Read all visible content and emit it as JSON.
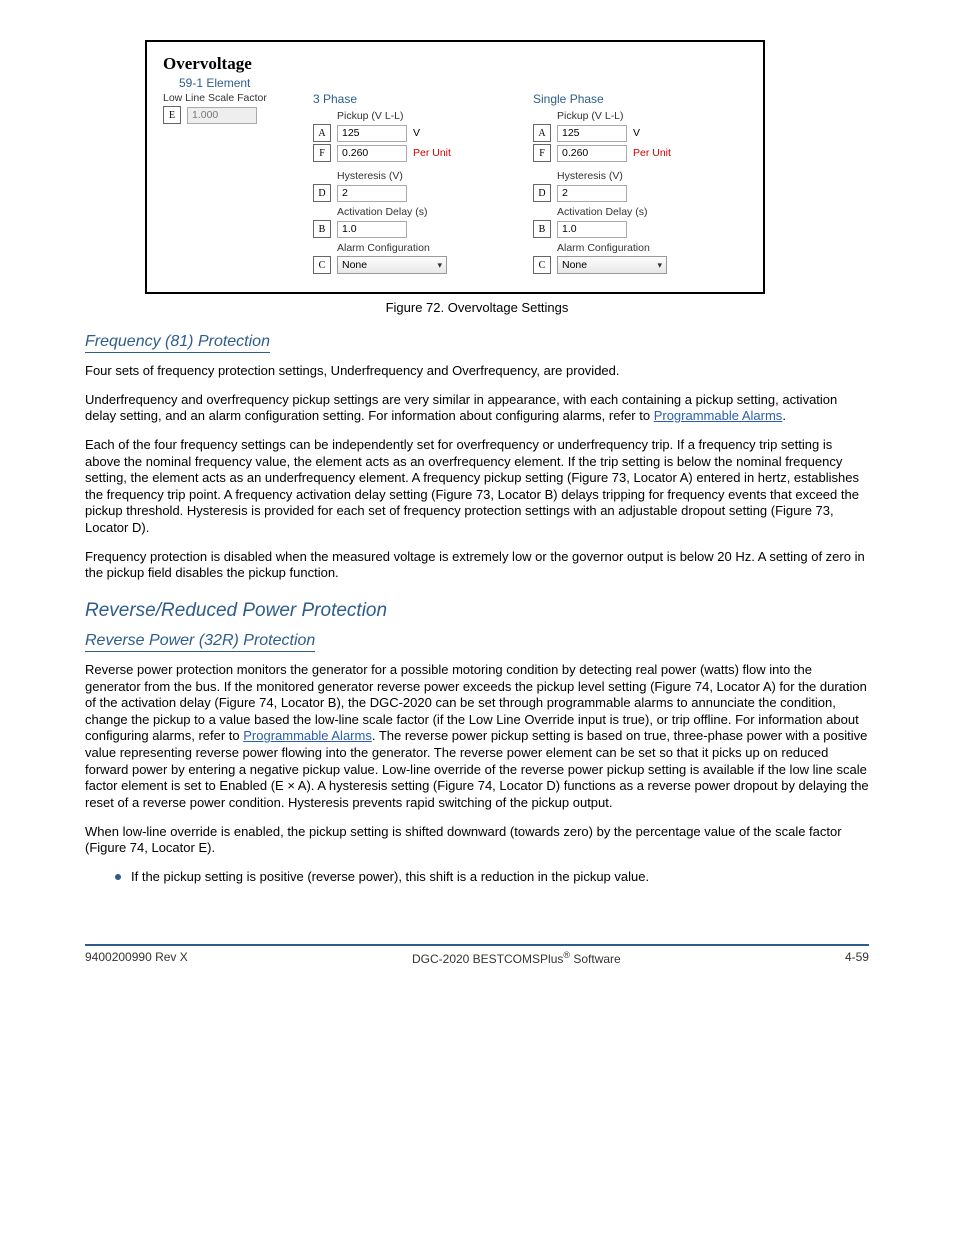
{
  "figure": {
    "panel_title": "Overvoltage",
    "group_title": "59-1 Element",
    "scale": {
      "label": "Low Line Scale Factor",
      "value": "1.000",
      "call": "E"
    },
    "columns": [
      {
        "heading": "3 Phase",
        "pickup_label": "Pickup (V L-L)",
        "pickup_val": "125",
        "pickup_unit": "V",
        "pickup_call": "A",
        "pu_val": "0.260",
        "pu_unit": "Per Unit",
        "pu_call": "F",
        "hyst_label": "Hysteresis (V)",
        "hyst_val": "2",
        "hyst_call": "D",
        "delay_label": "Activation Delay (s)",
        "delay_val": "1.0",
        "delay_call": "B",
        "alarm_label": "Alarm Configuration",
        "alarm_val": "None",
        "alarm_call": "C"
      },
      {
        "heading": "Single Phase",
        "pickup_label": "Pickup (V L-L)",
        "pickup_val": "125",
        "pickup_unit": "V",
        "pickup_call": "A",
        "pu_val": "0.260",
        "pu_unit": "Per Unit",
        "pu_call": "F",
        "hyst_label": "Hysteresis (V)",
        "hyst_val": "2",
        "hyst_call": "D",
        "delay_label": "Activation Delay (s)",
        "delay_val": "1.0",
        "delay_call": "B",
        "alarm_label": "Alarm Configuration",
        "alarm_val": "None",
        "alarm_call": "C"
      }
    ]
  },
  "caption": "Figure 72. Overvoltage Settings",
  "sect_a_title": "Frequency (81) Protection",
  "sect_a_p1": "Four sets of frequency protection settings, Underfrequency and Overfrequency, are provided.",
  "sect_a_p2a": "Underfrequency and overfrequency pickup settings are very similar in appearance, with each containing a pickup setting, activation delay setting, and an alarm configuration setting. For information about configuring alarms, refer to ",
  "sect_a_link": "Programmable Alarms",
  "sect_a_p2b": ".",
  "sect_a_p3": "Each of the four frequency settings can be independently set for overfrequency or underfrequency trip. If a frequency trip setting is above the nominal frequency value, the element acts as an overfrequency element. If the trip setting is below the nominal frequency setting, the element acts as an underfrequency element. A frequency pickup setting (Figure 73, Locator A) entered in hertz, establishes the frequency trip point. A frequency activation delay setting (Figure 73, Locator B) delays tripping for frequency events that exceed the pickup threshold. Hysteresis is provided for each set of frequency protection settings with an adjustable dropout setting (Figure 73, Locator D).",
  "sect_a_p4": "Frequency protection is disabled when the measured voltage is extremely low or the governor output is below 20 Hz. A setting of zero in the pickup field disables the pickup function.",
  "h2": "Reverse/Reduced Power Protection",
  "sub1_title": "Reverse Power (32R) Protection",
  "sub1_p1a": "Reverse power protection monitors the generator for a possible motoring condition by detecting real power (watts) flow into the generator from the bus. If the monitored generator reverse power exceeds the pickup level setting (Figure 74, Locator A) for the duration of the activation delay (Figure 74, Locator B), the DGC-2020 can be set through programmable alarms to annunciate the condition, change the pickup to a value based the low-line scale factor (if the Low Line Override input is true), or trip offline. For information about configuring alarms, refer to ",
  "sub1_p1b": ". The reverse power pickup setting is based on true, three-phase power with a positive value representing reverse power flowing into the generator. The reverse power element can be set so that it picks up on reduced forward power by entering a negative pickup value. Low-line override of the reverse power pickup setting is available if the low line scale factor element is set to Enabled (E × A). A hysteresis setting (Figure 74, Locator D) functions as a reverse power dropout by delaying the reset of a reverse power condition. Hysteresis prevents rapid switching of the pickup output.",
  "sub1_p2": "When low-line override is enabled, the pickup setting is shifted downward (towards zero) by the percentage value of the scale factor (Figure 74, Locator E).",
  "bullet": "If the pickup setting is positive (reverse power), this shift is a reduction in the pickup value.",
  "footer": {
    "left": "9400200990 Rev X",
    "mid_a": "DGC-2020 BESTCOMSPlus",
    "mid_b": " Software",
    "right": "4-59"
  }
}
